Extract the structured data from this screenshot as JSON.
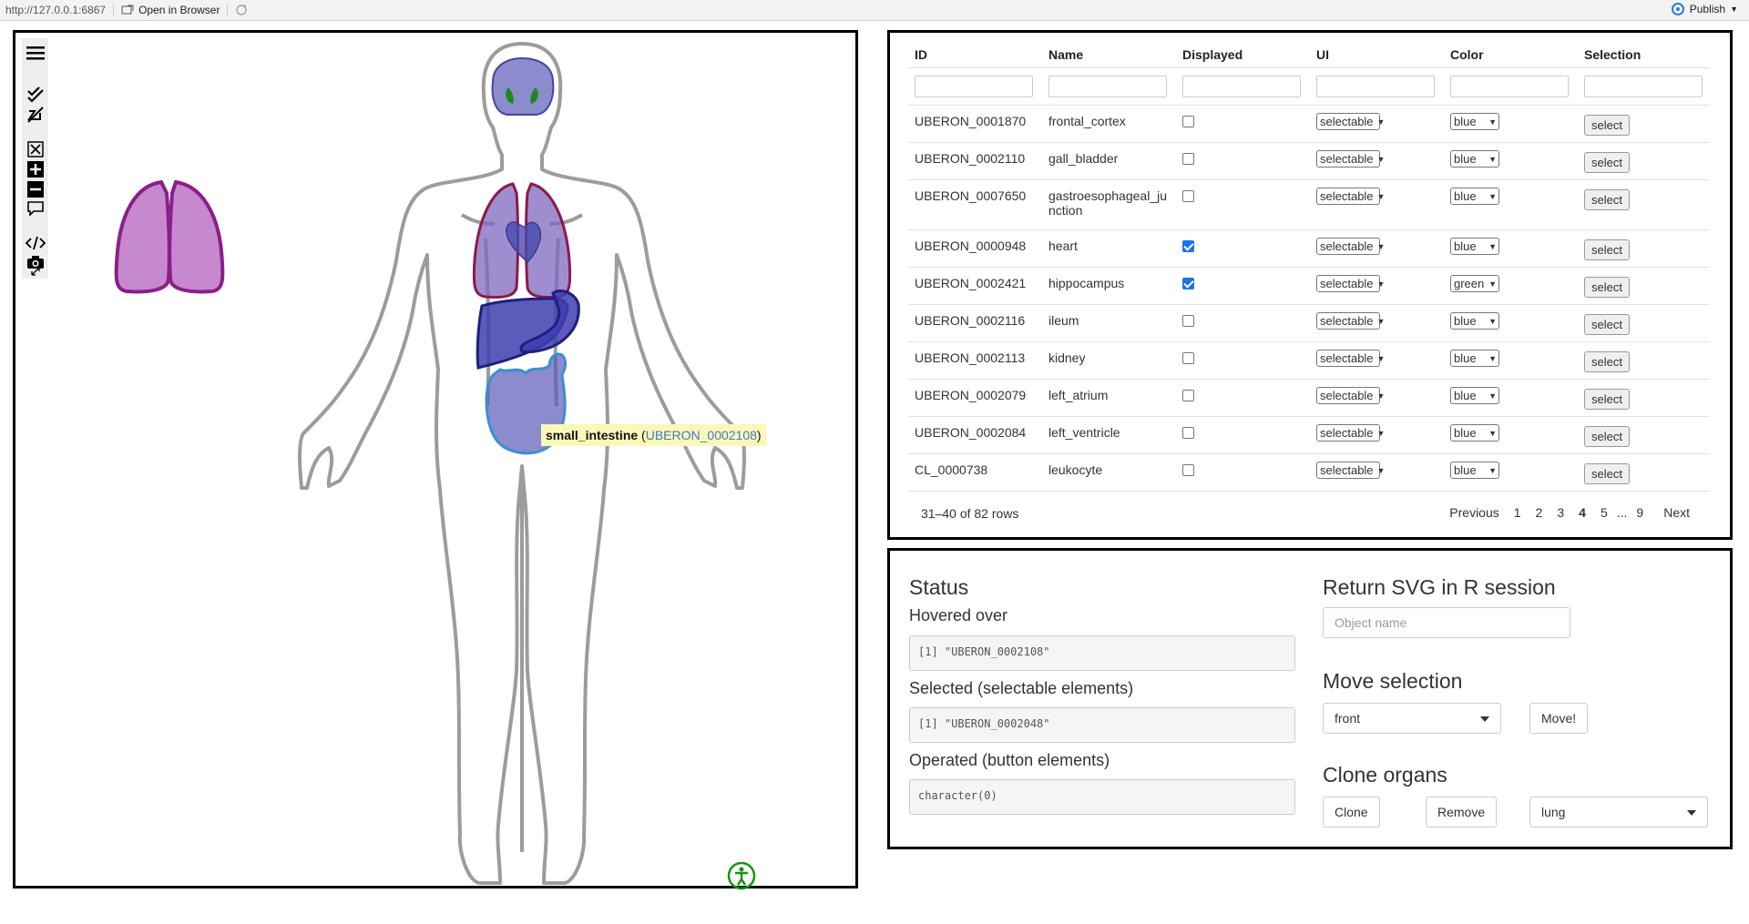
{
  "topbar": {
    "url": "http://127.0.0.1:6867",
    "open_browser": "Open in Browser",
    "publish": "Publish"
  },
  "body_view": {
    "tooltip_name": "small_intestine",
    "tooltip_id": "UBERON_0002108"
  },
  "table": {
    "columns": [
      "ID",
      "Name",
      "Displayed",
      "UI",
      "Color",
      "Selection"
    ],
    "rows": [
      {
        "id": "UBERON_0001870",
        "name": "frontal_cortex",
        "displayed": false,
        "ui": "selectable",
        "color": "blue",
        "action": "select"
      },
      {
        "id": "UBERON_0002110",
        "name": "gall_bladder",
        "displayed": false,
        "ui": "selectable",
        "color": "blue",
        "action": "select"
      },
      {
        "id": "UBERON_0007650",
        "name": "gastroesophageal_ju",
        "name2": "nction",
        "displayed": false,
        "ui": "selectable",
        "color": "blue",
        "action": "select"
      },
      {
        "id": "UBERON_0000948",
        "name": "heart",
        "displayed": true,
        "ui": "selectable",
        "color": "blue",
        "action": "select"
      },
      {
        "id": "UBERON_0002421",
        "name": "hippocampus",
        "displayed": true,
        "ui": "selectable",
        "color": "green",
        "action": "select"
      },
      {
        "id": "UBERON_0002116",
        "name": "ileum",
        "displayed": false,
        "ui": "selectable",
        "color": "blue",
        "action": "select"
      },
      {
        "id": "UBERON_0002113",
        "name": "kidney",
        "displayed": false,
        "ui": "selectable",
        "color": "blue",
        "action": "select"
      },
      {
        "id": "UBERON_0002079",
        "name": "left_atrium",
        "displayed": false,
        "ui": "selectable",
        "color": "blue",
        "action": "select"
      },
      {
        "id": "UBERON_0002084",
        "name": "left_ventricle",
        "displayed": false,
        "ui": "selectable",
        "color": "blue",
        "action": "select"
      },
      {
        "id": "CL_0000738",
        "name": "leukocyte",
        "displayed": false,
        "ui": "selectable",
        "color": "blue",
        "action": "select"
      }
    ],
    "info": "31–40 of 82 rows",
    "pager": {
      "previous": "Previous",
      "pages": [
        "1",
        "2",
        "3",
        "4",
        "5",
        "...",
        "9"
      ],
      "current": "4",
      "next": "Next"
    }
  },
  "status": {
    "title": "Status",
    "hovered_label": "Hovered over",
    "hovered_value": "[1] \"UBERON_0002108\"",
    "selected_label": "Selected (selectable elements)",
    "selected_value": "[1] \"UBERON_0002048\"",
    "operated_label": "Operated (button elements)",
    "operated_value": "character(0)",
    "return_title": "Return SVG in R session",
    "object_placeholder": "Object name",
    "move_title": "Move selection",
    "move_value": "front",
    "move_button": "Move!",
    "clone_title": "Clone organs",
    "clone_button": "Clone",
    "remove_button": "Remove",
    "clone_value": "lung"
  },
  "colors": {
    "organ_blue": "#5a5ab8",
    "lung_purple": "#b86bc0",
    "lung_border": "#8a1f8a",
    "selected_border": "#8c1a4a",
    "hover_border": "#3b8fd1",
    "hippocampus_green": "#1b8a1b",
    "accessibility_green": "#129612"
  }
}
